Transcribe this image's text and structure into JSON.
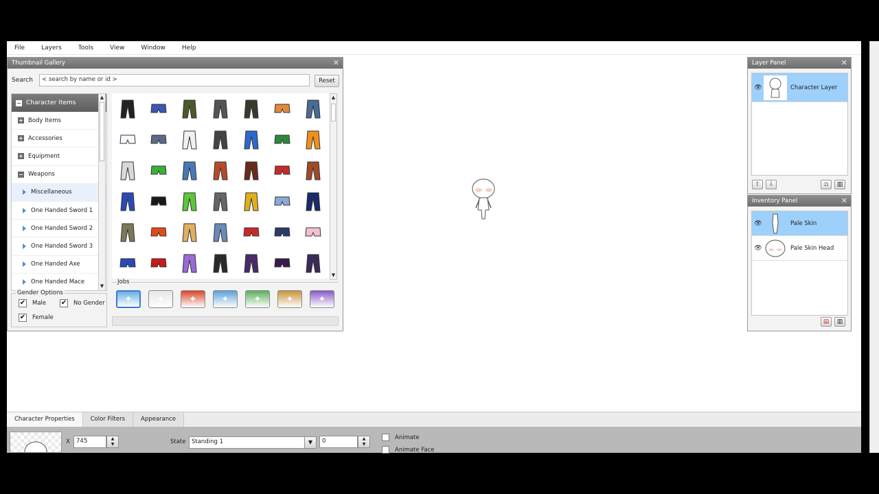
{
  "menu": [
    "File",
    "Layers",
    "Tools",
    "View",
    "Window",
    "Help"
  ],
  "gallery": {
    "title": "Thumbnail Gallery",
    "search_label": "Search",
    "search_placeholder": "< search by name or id >",
    "reset_label": "Reset",
    "tree_header": "Character Items",
    "tree_items": [
      {
        "label": "Body Items",
        "kind": "plus"
      },
      {
        "label": "Accessories",
        "kind": "plus"
      },
      {
        "label": "Equipment",
        "kind": "plus"
      },
      {
        "label": "Weapons",
        "kind": "minus"
      },
      {
        "label": "Miscellaneous",
        "kind": "tri",
        "selected": true
      },
      {
        "label": "One Handed Sword 1",
        "kind": "tri"
      },
      {
        "label": "One Handed Sword 2",
        "kind": "tri"
      },
      {
        "label": "One Handed Sword 3",
        "kind": "tri"
      },
      {
        "label": "One Handed Axe",
        "kind": "tri"
      },
      {
        "label": "One Handed Mace",
        "kind": "tri"
      }
    ],
    "gender_title": "Gender Options",
    "gender": {
      "male": "Male",
      "no_gender": "No Gender",
      "female": "Female"
    },
    "jobs_title": "Jobs",
    "job_colors": [
      "#6ab0e4",
      "#e6e6e6",
      "#d8472a",
      "#5aa2d8",
      "#5ab05a",
      "#c8943a",
      "#8a5ac8"
    ],
    "item_colors": [
      "#222222",
      "#3b56b8",
      "#4a5a2a",
      "#555555",
      "#3a3a2a",
      "#e08a3a",
      "#4a6a98",
      "#f4f8ff",
      "#5a6a88",
      "#f0f0f0",
      "#444444",
      "#2a6ad0",
      "#2a8a3a",
      "#f0901a",
      "#d8d8d8",
      "#3ab03a",
      "#4a78b8",
      "#b84a2a",
      "#6a2a1a",
      "#c82a2a",
      "#a04a2a",
      "#2a4ab8",
      "#1a1a1a",
      "#5ac83a",
      "#666666",
      "#e0b01a",
      "#8aa8d8",
      "#1a2a6a",
      "#7a7a5a",
      "#e04a1a",
      "#e0b060",
      "#6a8ab8",
      "#c82a2a",
      "#2a3a6a",
      "#f4c0d0",
      "#2a4ab8",
      "#c81a1a",
      "#9a6ad8",
      "#2a2a2a",
      "#4a2a6a",
      "#3a1a4a",
      "#3a2a5a"
    ]
  },
  "layer_panel": {
    "title": "Layer Panel",
    "layers": [
      {
        "label": "Character Layer"
      }
    ]
  },
  "inventory_panel": {
    "title": "Inventory Panel",
    "items": [
      {
        "label": "Pale Skin"
      },
      {
        "label": "Pale Skin Head"
      }
    ]
  },
  "bottom": {
    "tabs": [
      "Character Properties",
      "Color Filters",
      "Appearance"
    ],
    "x_label": "X",
    "x_value": "745",
    "state_label": "State",
    "state_value": "Standing 1",
    "frame_value": "0",
    "animate_label": "Animate",
    "animate_face_label": "Animate Face"
  }
}
